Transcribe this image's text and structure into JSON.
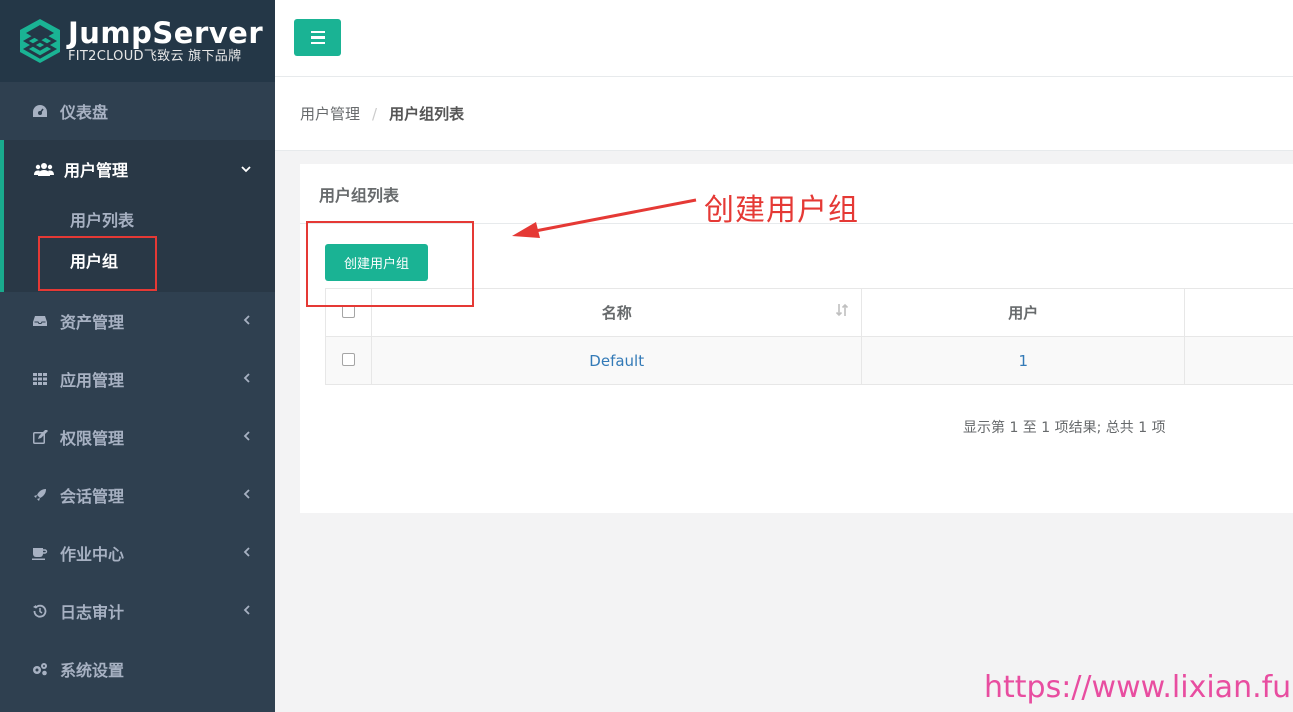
{
  "brand": {
    "title": "JumpServer",
    "subtitle": "FIT2CLOUD飞致云 旗下品牌"
  },
  "sidebar": {
    "items": [
      {
        "label": "仪表盘",
        "icon": "dashboard-icon"
      },
      {
        "label": "用户管理",
        "icon": "users-icon",
        "expanded": true,
        "children": [
          {
            "label": "用户列表"
          },
          {
            "label": "用户组",
            "active": true
          }
        ]
      },
      {
        "label": "资产管理",
        "icon": "inbox-icon"
      },
      {
        "label": "应用管理",
        "icon": "grid-icon"
      },
      {
        "label": "权限管理",
        "icon": "edit-icon"
      },
      {
        "label": "会话管理",
        "icon": "rocket-icon"
      },
      {
        "label": "作业中心",
        "icon": "coffee-icon"
      },
      {
        "label": "日志审计",
        "icon": "history-icon"
      },
      {
        "label": "系统设置",
        "icon": "gears-icon"
      }
    ]
  },
  "breadcrumb": {
    "parent": "用户管理",
    "current": "用户组列表"
  },
  "panel": {
    "title": "用户组列表",
    "create_button": "创建用户组",
    "table": {
      "headers": [
        "名称",
        "用户"
      ],
      "rows": [
        {
          "name": "Default",
          "users": "1"
        }
      ]
    },
    "pager_info": "显示第 1 至 1 项结果; 总共 1 项"
  },
  "annotation": {
    "text": "创建用户组",
    "color": "#e53935"
  },
  "watermark": "https://www.lixian.fun",
  "colors": {
    "accent": "#1ab394",
    "sidebar": "#2f4050",
    "link": "#337ab7"
  }
}
